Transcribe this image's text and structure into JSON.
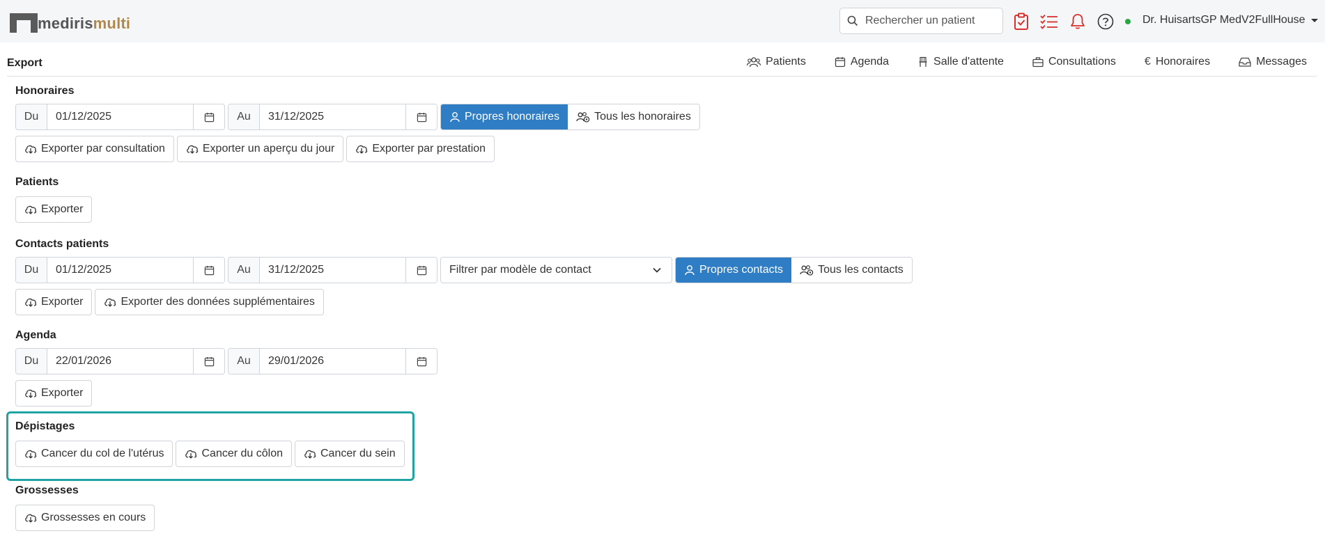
{
  "app": {
    "logo_part1": "medi",
    "logo_part2": "ris",
    "logo_part3": "multi"
  },
  "topbar": {
    "search_placeholder": "Rechercher un patient",
    "user_name": "Dr. HuisartsGP MedV2FullHouse",
    "status_color": "#28a745",
    "icons": [
      "clipboard-check-icon",
      "tasks-icon",
      "bell-icon",
      "help-icon"
    ]
  },
  "page": {
    "title": "Export"
  },
  "nav": [
    {
      "label": "Patients",
      "icon": "users-icon"
    },
    {
      "label": "Agenda",
      "icon": "calendar-icon"
    },
    {
      "label": "Salle d'attente",
      "icon": "chair-icon"
    },
    {
      "label": "Consultations",
      "icon": "briefcase-icon"
    },
    {
      "label": "Honoraires",
      "icon": "euro-icon"
    },
    {
      "label": "Messages",
      "icon": "inbox-icon"
    }
  ],
  "honoraires": {
    "title": "Honoraires",
    "from_label": "Du",
    "from_value": "01/12/2025",
    "to_label": "Au",
    "to_value": "31/12/2025",
    "own_label": "Propres honoraires",
    "all_label": "Tous les honoraires",
    "btn_consultation": "Exporter par consultation",
    "btn_day": "Exporter un aperçu du jour",
    "btn_prestation": "Exporter par prestation"
  },
  "patients": {
    "title": "Patients",
    "export_label": "Exporter"
  },
  "contacts": {
    "title": "Contacts patients",
    "from_label": "Du",
    "from_value": "01/12/2025",
    "to_label": "Au",
    "to_value": "31/12/2025",
    "filter_value": "Filtrer par modèle de contact",
    "own_label": "Propres contacts",
    "all_label": "Tous les contacts",
    "export_label": "Exporter",
    "extra_label": "Exporter des données supplémentaires"
  },
  "agenda": {
    "title": "Agenda",
    "from_label": "Du",
    "from_value": "22/01/2026",
    "to_label": "Au",
    "to_value": "29/01/2026",
    "export_label": "Exporter"
  },
  "depistages": {
    "title": "Dépistages",
    "cervical": "Cancer du col de l'utérus",
    "colon": "Cancer du côlon",
    "breast": "Cancer du sein",
    "highlight_color": "#1fa3a3"
  },
  "grossesses": {
    "title": "Grossesses",
    "current_label": "Grossesses en cours"
  },
  "colors": {
    "primary": "#2f7dc4",
    "alert_red": "#d9302c",
    "logo_gold": "#b0894a"
  }
}
